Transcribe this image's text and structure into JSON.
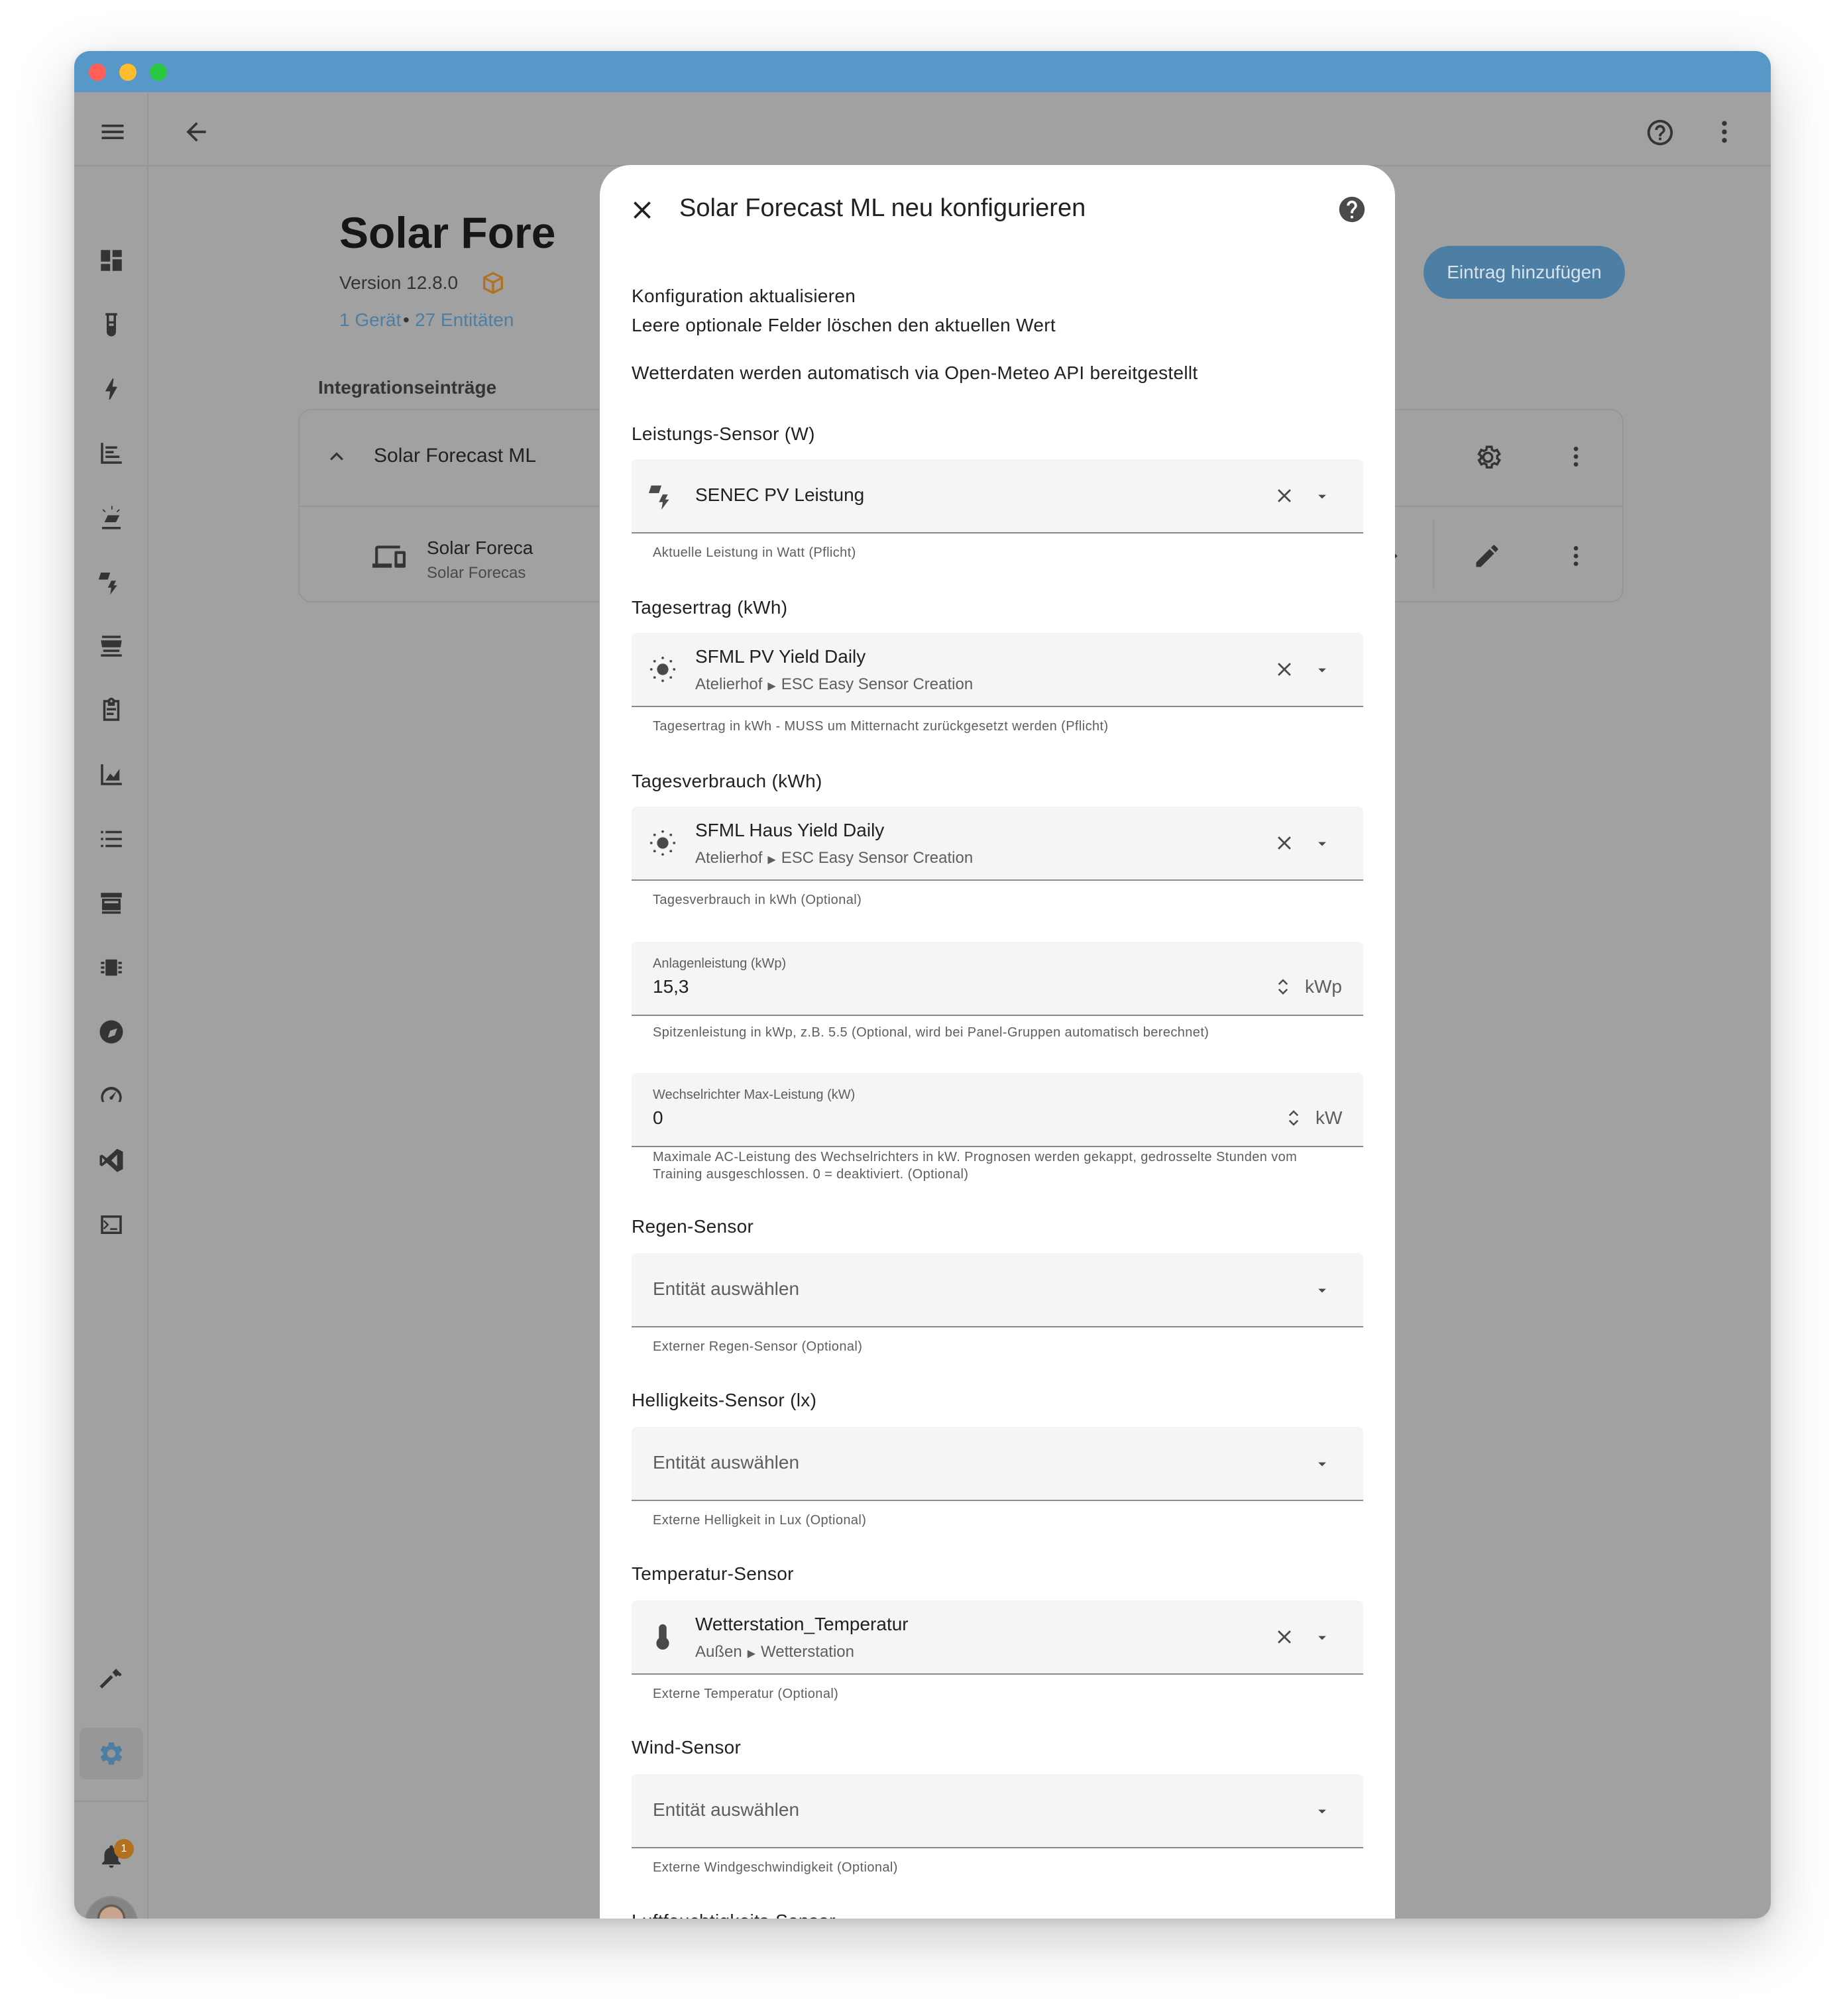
{
  "background": {
    "page_title": "Solar Fore",
    "version": "Version 12.8.0",
    "device_link": "1 Gerät",
    "separator": "•",
    "entities_link": "27 Entitäten",
    "section_title": "Integrationseinträge",
    "add_entry_button": "Eintrag hinzufügen",
    "entry_title": "Solar Forecast ML",
    "device_name": "Solar Foreca",
    "device_sub": "Solar Forecas",
    "notification_badge": "1"
  },
  "colors": {
    "titlebar": "#5898c8",
    "accent": "#4d7ea3",
    "overlay_bg": "#a1a1a1",
    "badge": "#b3701e"
  },
  "dialog": {
    "title": "Solar Forecast ML neu konfigurieren",
    "intro_1": "Konfiguration aktualisieren",
    "intro_2": "Leere optionale Felder löschen den aktuellen Wert",
    "intro_3": "Wetterdaten werden automatisch via Open-Meteo API bereitgestellt",
    "fields": {
      "power": {
        "label": "Leistungs-Sensor (W)",
        "value": "SENEC PV Leistung",
        "icon": "solar-power-icon",
        "helper": "Aktuelle Leistung in Watt (Pflicht)"
      },
      "yield": {
        "label": "Tagesertrag (kWh)",
        "value": "SFML PV Yield Daily",
        "area": "Atelierhof",
        "device": "ESC Easy Sensor Creation",
        "icon": "sun-icon",
        "helper": "Tagesertrag in kWh - MUSS um Mitternacht zurückgesetzt werden (Pflicht)"
      },
      "consumption": {
        "label": "Tagesverbrauch (kWh)",
        "value": "SFML Haus Yield Daily",
        "area": "Atelierhof",
        "device": "ESC Easy Sensor Creation",
        "icon": "sun-icon",
        "helper": "Tagesverbrauch in kWh (Optional)"
      },
      "kwp": {
        "label": "Anlagenleistung (kWp)",
        "value": "15,3",
        "unit": "kWp",
        "helper": "Spitzenleistung in kWp, z.B. 5.5 (Optional, wird bei Panel-Gruppen automatisch berechnet)"
      },
      "inverter": {
        "label": "Wechselrichter Max-Leistung (kW)",
        "value": "0",
        "unit": "kW",
        "helper_1": "Maximale AC-Leistung des Wechselrichters in kW. Prognosen werden gekappt, gedrosselte Stunden vom",
        "helper_2": "Training ausgeschlossen. 0 = deaktiviert. (Optional)"
      },
      "rain": {
        "label": "Regen-Sensor",
        "placeholder": "Entität auswählen",
        "helper": "Externer Regen-Sensor (Optional)"
      },
      "lux": {
        "label": "Helligkeits-Sensor (lx)",
        "placeholder": "Entität auswählen",
        "helper": "Externe Helligkeit in Lux (Optional)"
      },
      "temperature": {
        "label": "Temperatur-Sensor",
        "value": "Wetterstation_Temperatur",
        "area": "Außen",
        "device": "Wetterstation",
        "icon": "thermometer-icon",
        "helper": "Externe Temperatur (Optional)"
      },
      "wind": {
        "label": "Wind-Sensor",
        "placeholder": "Entität auswählen",
        "helper": "Externe Windgeschwindigkeit (Optional)"
      },
      "humidity": {
        "label": "Luftfeuchtigkeits-Sensor"
      }
    }
  }
}
